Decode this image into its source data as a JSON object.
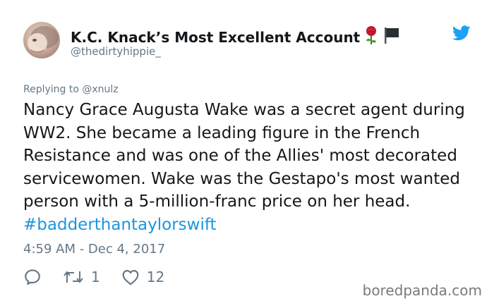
{
  "user": {
    "display_name": "K.C. Knack’s Most Excellent Account",
    "handle": "@thedirtyhippie_",
    "name_emojis": [
      "rose-emoji",
      "black-flag-emoji"
    ]
  },
  "tweet": {
    "reply_to": "Replying to @xnulz",
    "text": "Nancy Grace Augusta Wake was a secret agent during WW2. She became a leading figure in the French Resistance and was one of the Allies' most decorated servicewomen. Wake was the Gestapo's most wanted person with a 5-million-franc price on her head.",
    "hashtag": "#badderthantaylorswift",
    "timestamp": "4:59 AM - Dec 4, 2017",
    "retweet_count": "1",
    "like_count": "12"
  },
  "watermark": "boredpanda.com",
  "colors": {
    "text": "#14171a",
    "secondary": "#657786",
    "link": "#1b95e0",
    "twitter_blue": "#1da1f2"
  },
  "icons": [
    "reply-icon",
    "retweet-icon",
    "heart-icon",
    "twitter-bird-icon"
  ]
}
